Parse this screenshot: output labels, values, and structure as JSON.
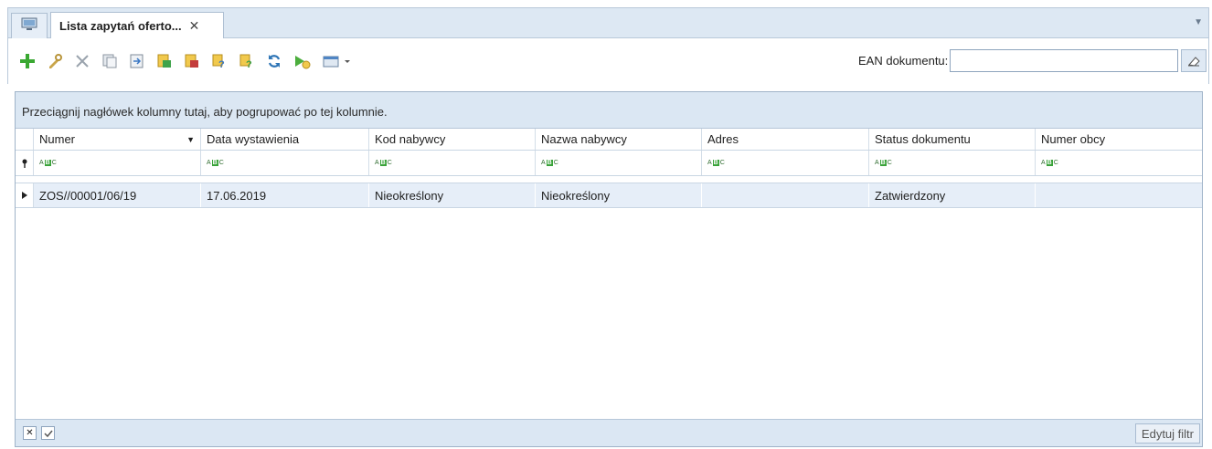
{
  "tabs": {
    "active_label": "Lista zapytań oferto...",
    "close_glyph": "✕"
  },
  "toolbar": {
    "icons": [
      "add-icon",
      "edit-icon",
      "delete-icon",
      "copy-icon",
      "export-icon",
      "generate-icon",
      "generate-plus-icon",
      "help-icon",
      "help-plus-icon",
      "refresh-icon",
      "run-icon",
      "view-options-icon"
    ],
    "ean_label": "EAN dokumentu:",
    "ean_value": "",
    "clear_icon": "eraser-icon"
  },
  "grid": {
    "group_hint": "Przeciągnij nagłówek kolumny tutaj, aby pogrupować po tej kolumnie.",
    "columns": [
      "Numer",
      "Data wystawienia",
      "Kod nabywcy",
      "Nazwa nabywcy",
      "Adres",
      "Status dokumentu",
      "Numer obcy"
    ],
    "sort_column": "Numer",
    "rows": [
      [
        "ZOS//00001/06/19",
        "17.06.2019",
        "Nieokreślony",
        "Nieokreślony",
        "",
        "Zatwierdzony",
        ""
      ]
    ],
    "filter_placeholder": "ABC"
  },
  "footer": {
    "edit_filter_label": "Edytuj filtr"
  },
  "colors": {
    "accent": "#2e75b6",
    "panel": "#dbe7f3",
    "selected_row": "#e6eef8"
  }
}
